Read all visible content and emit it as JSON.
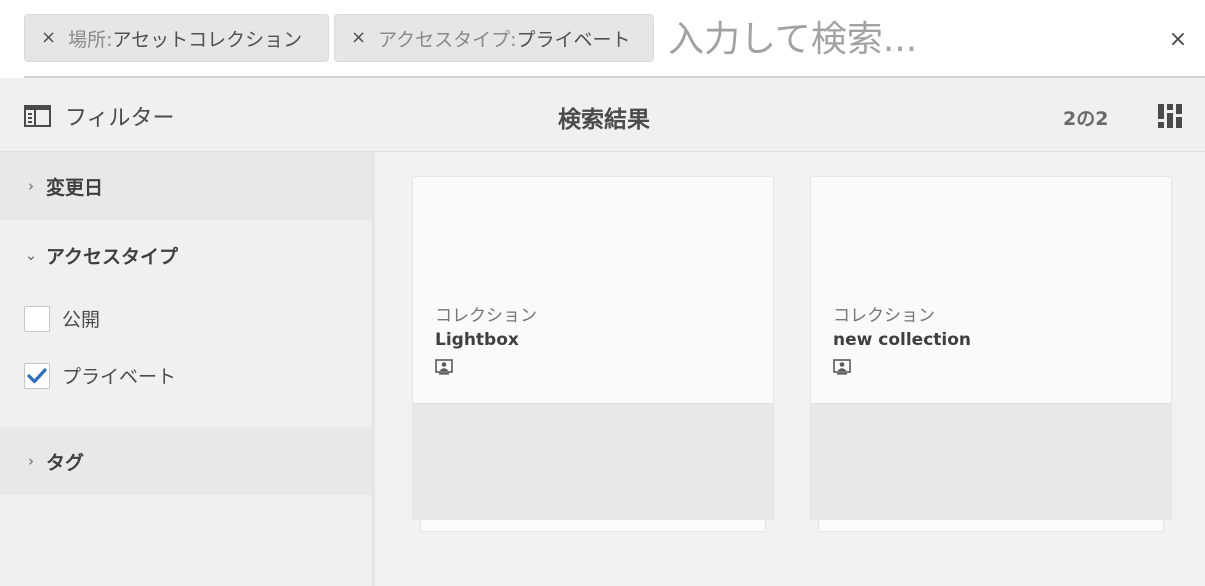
{
  "search": {
    "tags": [
      {
        "key": "場所:",
        "value": "アセットコレクション"
      },
      {
        "key": "アクセスタイプ:",
        "value": "プライベート"
      }
    ],
    "placeholder": "入力して検索...",
    "clear_label": "×",
    "tag_close_label": "×"
  },
  "toolbar": {
    "filter_label": "フィルター",
    "title": "検索結果",
    "count": "2の2",
    "icons": {
      "filter": "sidebar-panel-icon",
      "view": "card-view-icon"
    }
  },
  "filters": {
    "modified_date": {
      "label": "変更日",
      "expanded": false
    },
    "access_type": {
      "label": "アクセスタイプ",
      "expanded": true,
      "options": [
        {
          "label": "公開",
          "checked": false
        },
        {
          "label": "プライベート",
          "checked": true
        }
      ]
    },
    "tags": {
      "label": "タグ",
      "expanded": false
    }
  },
  "results": [
    {
      "type": "コレクション",
      "name": "Lightbox",
      "icon": "private-collection-icon"
    },
    {
      "type": "コレクション",
      "name": "new collection",
      "icon": "private-collection-icon"
    }
  ],
  "colors": {
    "checkbox_check": "#2d6fbb",
    "toolbar_bg": "#f0f0f0"
  }
}
